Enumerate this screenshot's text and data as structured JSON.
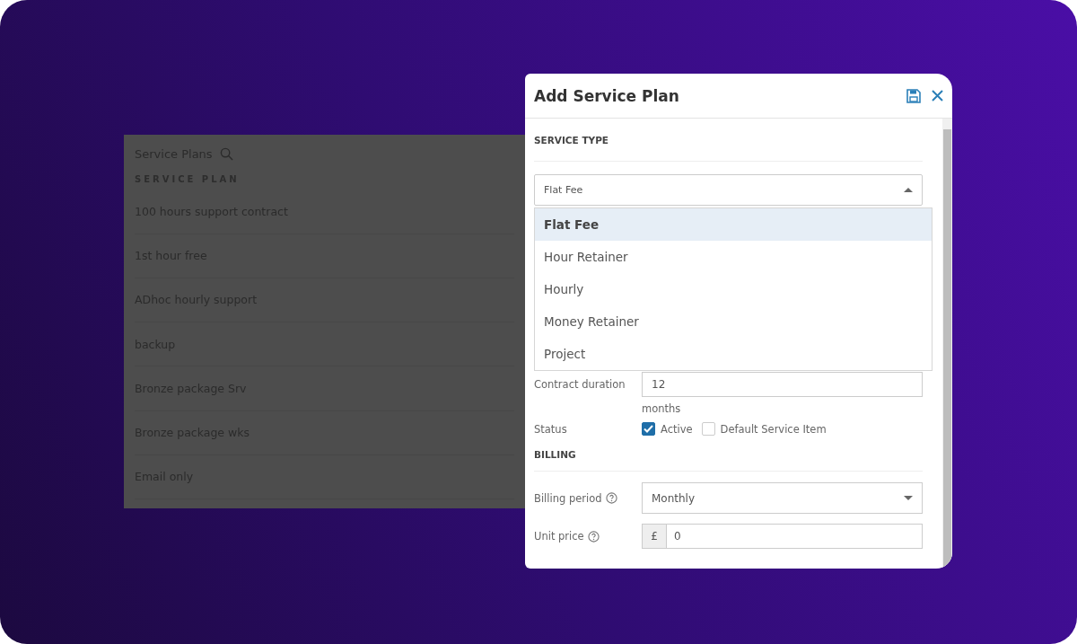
{
  "background_panel": {
    "title": "Service Plans",
    "column_header": "SERVICE PLAN",
    "rows": [
      {
        "name": "100 hours support contract"
      },
      {
        "name": "1st hour free"
      },
      {
        "name": "ADhoc hourly support"
      },
      {
        "name": "backup"
      },
      {
        "name": "Bronze package Srv"
      },
      {
        "name": "Bronze package wks"
      },
      {
        "name": "Email only"
      }
    ]
  },
  "dialog": {
    "title": "Add Service Plan",
    "service_type": {
      "heading": "SERVICE TYPE",
      "value": "Flat Fee",
      "expanded": true,
      "options": [
        {
          "label": "Flat Fee",
          "selected": true
        },
        {
          "label": "Hour Retainer",
          "selected": false
        },
        {
          "label": "Hourly",
          "selected": false
        },
        {
          "label": "Money Retainer",
          "selected": false
        },
        {
          "label": "Project",
          "selected": false
        }
      ]
    },
    "contract_duration": {
      "label": "Contract duration",
      "value": "12",
      "unit": "months"
    },
    "status": {
      "label": "Status",
      "options": [
        {
          "label": "Active",
          "checked": true
        },
        {
          "label": "Default Service Item",
          "checked": false
        }
      ]
    },
    "billing": {
      "heading": "BILLING",
      "billing_period": {
        "label": "Billing period",
        "value": "Monthly"
      },
      "unit_price": {
        "label": "Unit price",
        "currency": "£",
        "value": "0"
      }
    }
  }
}
